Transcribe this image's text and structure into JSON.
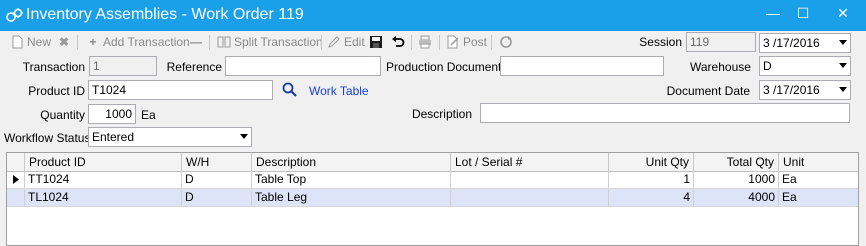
{
  "window": {
    "title": "Inventory Assemblies - Work Order 119",
    "minimize": "—",
    "maximize": "☐",
    "close": "✕",
    "accent": "#1aa0e8"
  },
  "toolbar": {
    "new": "New",
    "add_transaction": "Add Transaction",
    "split_transaction": "Split Transaction",
    "edit": "Edit",
    "post": "Post",
    "session_label": "Session",
    "session_value": "119",
    "session_date": "3 /17/2016"
  },
  "form": {
    "transaction_label": "Transaction",
    "transaction_value": "1",
    "reference_label": "Reference",
    "reference_value": "",
    "production_document_label": "Production Document",
    "production_document_value": "",
    "warehouse_label": "Warehouse",
    "warehouse_value": "D",
    "product_id_label": "Product ID",
    "product_id_value": "T1024",
    "work_table_link": "Work Table",
    "document_date_label": "Document Date",
    "document_date_value": "3 /17/2016",
    "quantity_label": "Quantity",
    "quantity_value": "1000",
    "quantity_unit": "Ea",
    "description_label": "Description",
    "description_value": "",
    "workflow_status_label": "Workflow Status",
    "workflow_status_value": "Entered"
  },
  "grid": {
    "columns": [
      "Product ID",
      "W/H",
      "Description",
      "Lot / Serial #",
      "Unit Qty",
      "Total Qty",
      "Unit"
    ],
    "rows": [
      {
        "product_id": "TT1024",
        "wh": "D",
        "description": "Table Top",
        "lot_serial": "",
        "unit_qty": "1",
        "total_qty": "1000",
        "unit": "Ea"
      },
      {
        "product_id": "TL1024",
        "wh": "D",
        "description": "Table Leg",
        "lot_serial": "",
        "unit_qty": "4",
        "total_qty": "4000",
        "unit": "Ea"
      }
    ]
  }
}
